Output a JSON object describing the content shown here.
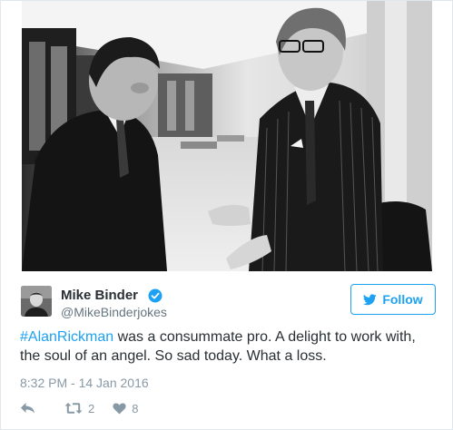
{
  "tweet": {
    "author_name": "Mike Binder",
    "author_handle": "@MikeBinderjokes",
    "follow_label": "Follow",
    "hashtag": "#AlanRickman",
    "text": " was a consummate pro. A delight to work with, the soul of an angel. So sad today. What a loss.",
    "timestamp": "8:32 PM - 14 Jan 2016",
    "retweet_count": "2",
    "like_count": "8"
  },
  "colors": {
    "accent": "#1da1f2",
    "text": "#292f33",
    "muted": "#8899a6",
    "border": "#e1e8ed"
  },
  "icons": [
    "verified-badge-icon",
    "twitter-bird-icon",
    "reply-icon",
    "retweet-icon",
    "heart-icon"
  ]
}
